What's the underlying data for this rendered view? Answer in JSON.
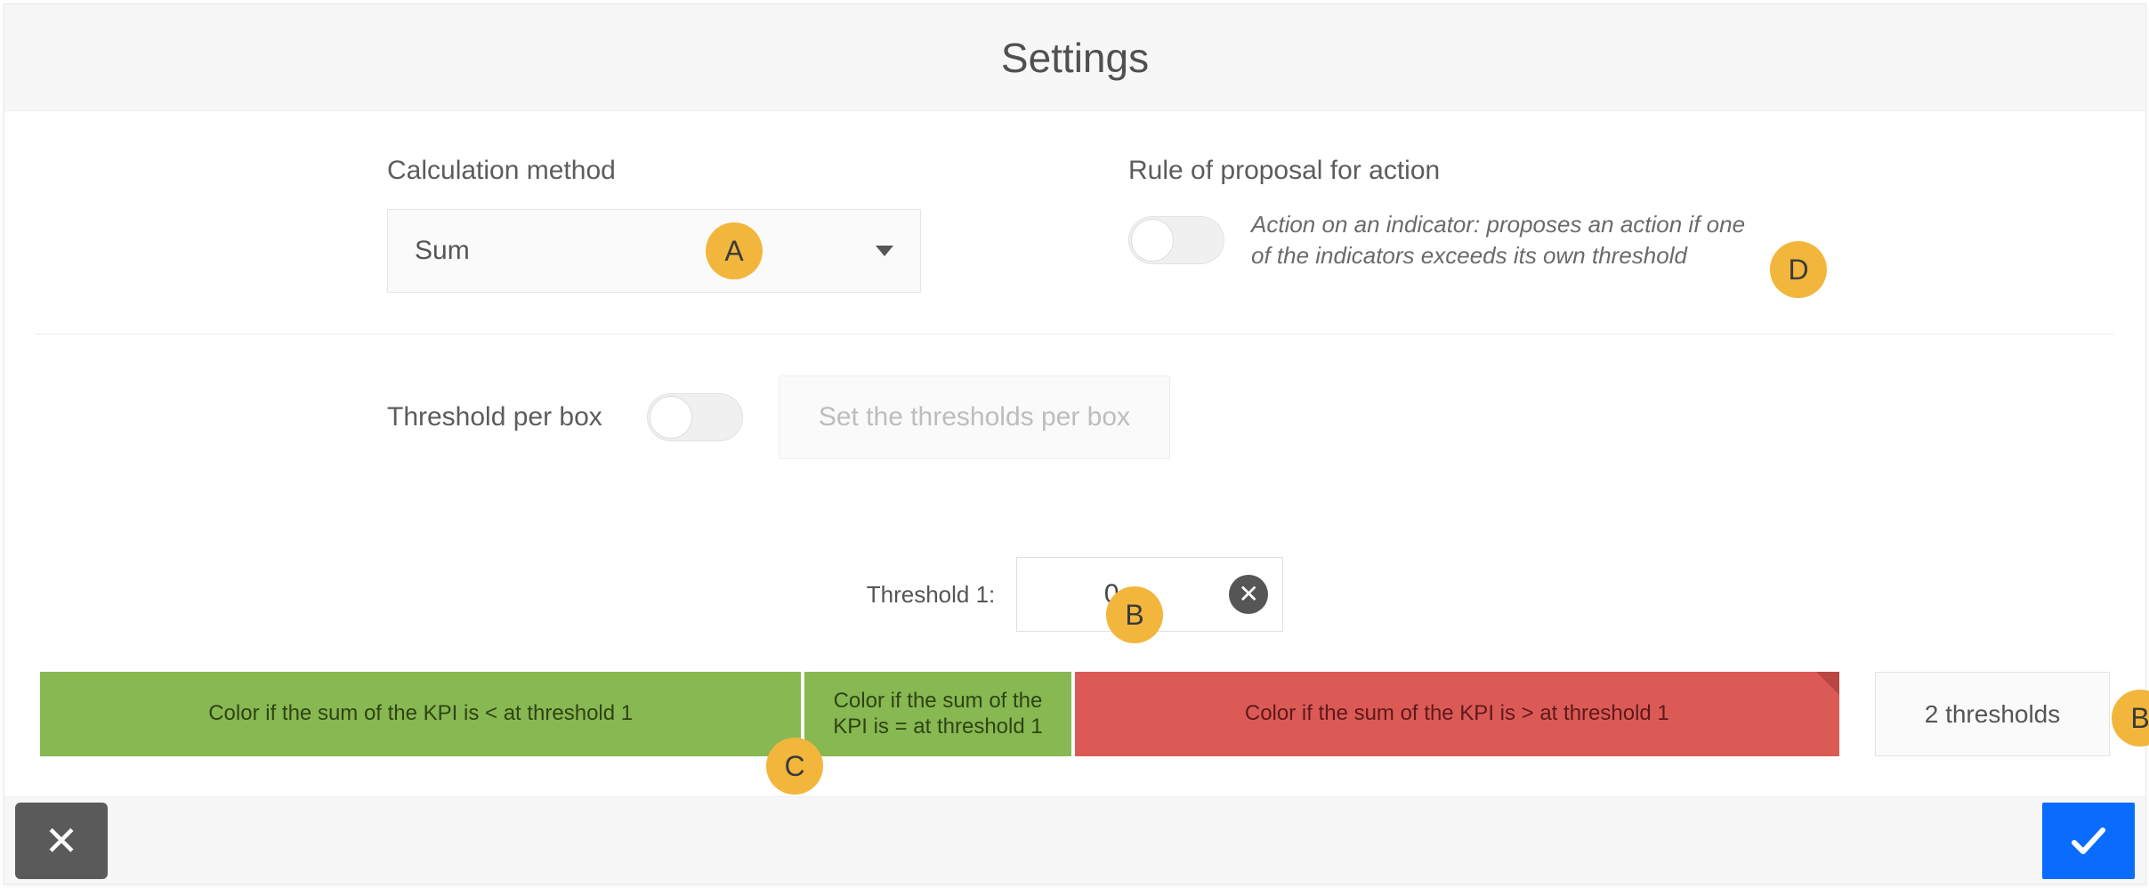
{
  "header": {
    "title": "Settings"
  },
  "calc": {
    "label": "Calculation method",
    "selected": "Sum"
  },
  "rule": {
    "label": "Rule of proposal for action",
    "description": "Action on an indicator: proposes an action if one of the indicators exceeds its own threshold"
  },
  "threshold_per_box": {
    "label": "Threshold per box",
    "button": "Set the thresholds per box"
  },
  "threshold1": {
    "label": "Threshold 1:",
    "value": "0"
  },
  "bands": {
    "lt": "Color if the sum of the KPI is < at threshold 1",
    "eq": "Color if the sum of the KPI is = at threshold 1",
    "gt": "Color if the sum of the KPI is > at threshold 1"
  },
  "thresholds_button": "2 thresholds",
  "markers": {
    "A": "A",
    "B": "B",
    "C": "C",
    "D": "D"
  }
}
